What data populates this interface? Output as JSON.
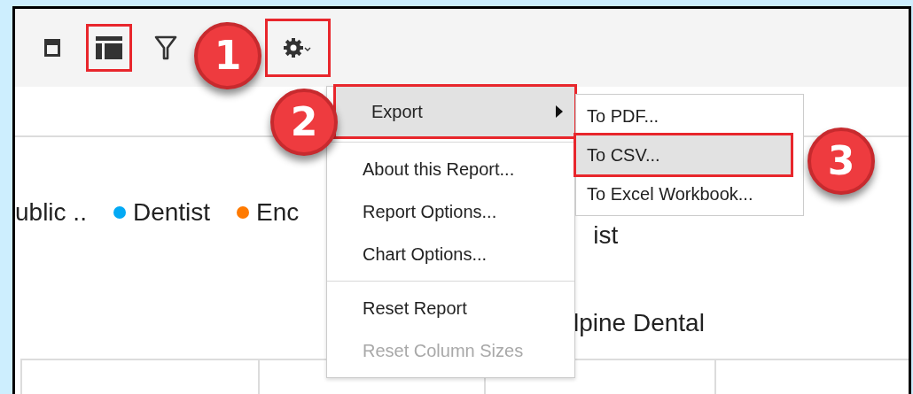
{
  "toolbar": {
    "buttons": [
      {
        "kind": "panel",
        "highlighted": false
      },
      {
        "kind": "layout",
        "highlighted": true
      },
      {
        "kind": "filter",
        "highlighted": false
      },
      {
        "kind": "gear",
        "highlighted": true
      }
    ]
  },
  "legend": {
    "items": [
      {
        "label": "ublic .."
      },
      {
        "label": "Dentist",
        "color": "#03a9f4"
      },
      {
        "label": "Enc",
        "color": "#ff7a00"
      }
    ],
    "trailing_fragment": "ist"
  },
  "chart_title": "lpine Dental",
  "menu": {
    "items": [
      {
        "label": "Export",
        "kind": "submenu",
        "highlighted": true,
        "disabled": false
      },
      {
        "kind": "separator"
      },
      {
        "label": "About this Report...",
        "kind": "item",
        "highlighted": false,
        "disabled": false
      },
      {
        "label": "Report Options...",
        "kind": "item",
        "highlighted": false,
        "disabled": false
      },
      {
        "label": "Chart Options...",
        "kind": "item",
        "highlighted": false,
        "disabled": false
      },
      {
        "kind": "separator"
      },
      {
        "label": "Reset Report",
        "kind": "item",
        "highlighted": false,
        "disabled": false
      },
      {
        "label": "Reset Column Sizes",
        "kind": "item",
        "highlighted": false,
        "disabled": true
      }
    ]
  },
  "submenu": {
    "items": [
      {
        "label": "To PDF...",
        "highlighted": false
      },
      {
        "label": "To CSV...",
        "highlighted": true
      },
      {
        "label": "To Excel Workbook...",
        "highlighted": false
      }
    ]
  },
  "callouts": [
    {
      "label": "1"
    },
    {
      "label": "2"
    },
    {
      "label": "3"
    }
  ]
}
